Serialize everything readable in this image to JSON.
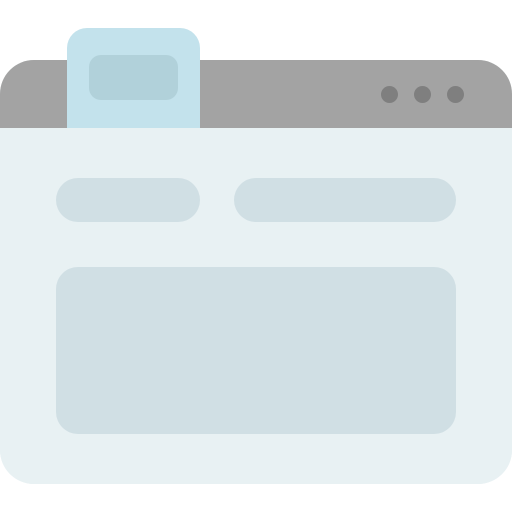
{
  "window": {
    "titlebar_dots": [
      "dot-1",
      "dot-2",
      "dot-3"
    ],
    "active_tab": {
      "icon": "tab-icon"
    },
    "content": {
      "left_field": "field-placeholder",
      "right_field": "field-placeholder",
      "main_panel": "panel-placeholder"
    }
  },
  "colors": {
    "titlebar": "#a3a3a3",
    "dots": "#7f7f7f",
    "content_bg": "#e8f1f3",
    "tab": "#c3e2ec",
    "tab_inner": "#b1d1da",
    "placeholders": "#d0dfe4"
  }
}
